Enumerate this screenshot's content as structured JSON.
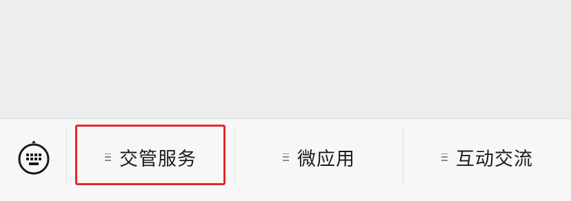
{
  "menu": {
    "items": [
      {
        "label": "交管服务",
        "icon": "menu-lines-icon"
      },
      {
        "label": "微应用",
        "icon": "menu-lines-icon"
      },
      {
        "label": "互动交流",
        "icon": "menu-lines-icon"
      }
    ],
    "keyboard_toggle_icon": "keyboard-icon"
  },
  "highlight": {
    "color": "#e5262a",
    "target": "交管服务"
  },
  "colors": {
    "background": "#ededed",
    "bar": "#f7f7f7",
    "divider": "#dcdcdc"
  }
}
